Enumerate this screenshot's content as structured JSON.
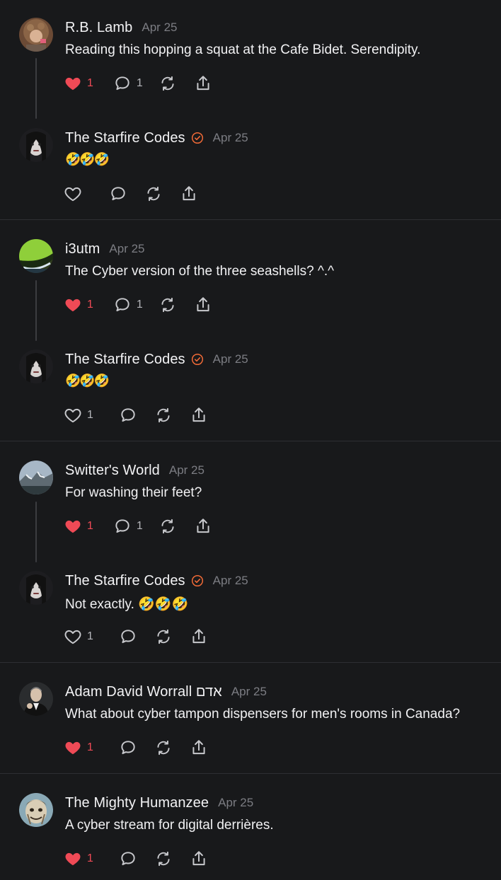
{
  "colors": {
    "background": "#18191b",
    "liked": "#ef4a56",
    "verified": "#f06a37",
    "muted": "#7c7d83"
  },
  "posts": [
    {
      "name": "R.B. Lamb",
      "verified": false,
      "date": "Apr 25",
      "text": "Reading this hopping a squat at the Cafe Bidet. Serendipity.",
      "liked": true,
      "likes": "1",
      "replies": "1"
    },
    {
      "name": "The Starfire Codes",
      "verified": true,
      "date": "Apr 25",
      "text": "🤣🤣🤣",
      "liked": false,
      "likes": "",
      "replies": ""
    },
    {
      "name": "i3utm",
      "verified": false,
      "date": "Apr 25",
      "text": "The Cyber version of the three seashells? ^.^",
      "liked": true,
      "likes": "1",
      "replies": "1"
    },
    {
      "name": "The Starfire Codes",
      "verified": true,
      "date": "Apr 25",
      "text": "🤣🤣🤣",
      "liked": false,
      "likes": "1",
      "replies": ""
    },
    {
      "name": "Switter's World",
      "verified": false,
      "date": "Apr 25",
      "text": "For washing their feet?",
      "liked": true,
      "likes": "1",
      "replies": "1"
    },
    {
      "name": "The Starfire Codes",
      "verified": true,
      "date": "Apr 25",
      "text": "Not exactly. 🤣🤣🤣",
      "liked": false,
      "likes": "1",
      "replies": ""
    },
    {
      "name": "Adam David Worrall אדם",
      "verified": false,
      "date": "Apr 25",
      "text": "What about cyber tampon dispensers for men's rooms in Canada?",
      "liked": true,
      "likes": "1",
      "replies": ""
    },
    {
      "name": "The Mighty Humanzee",
      "verified": false,
      "date": "Apr 25",
      "text": "A cyber stream for digital derrières.",
      "liked": true,
      "likes": "1",
      "replies": ""
    }
  ]
}
